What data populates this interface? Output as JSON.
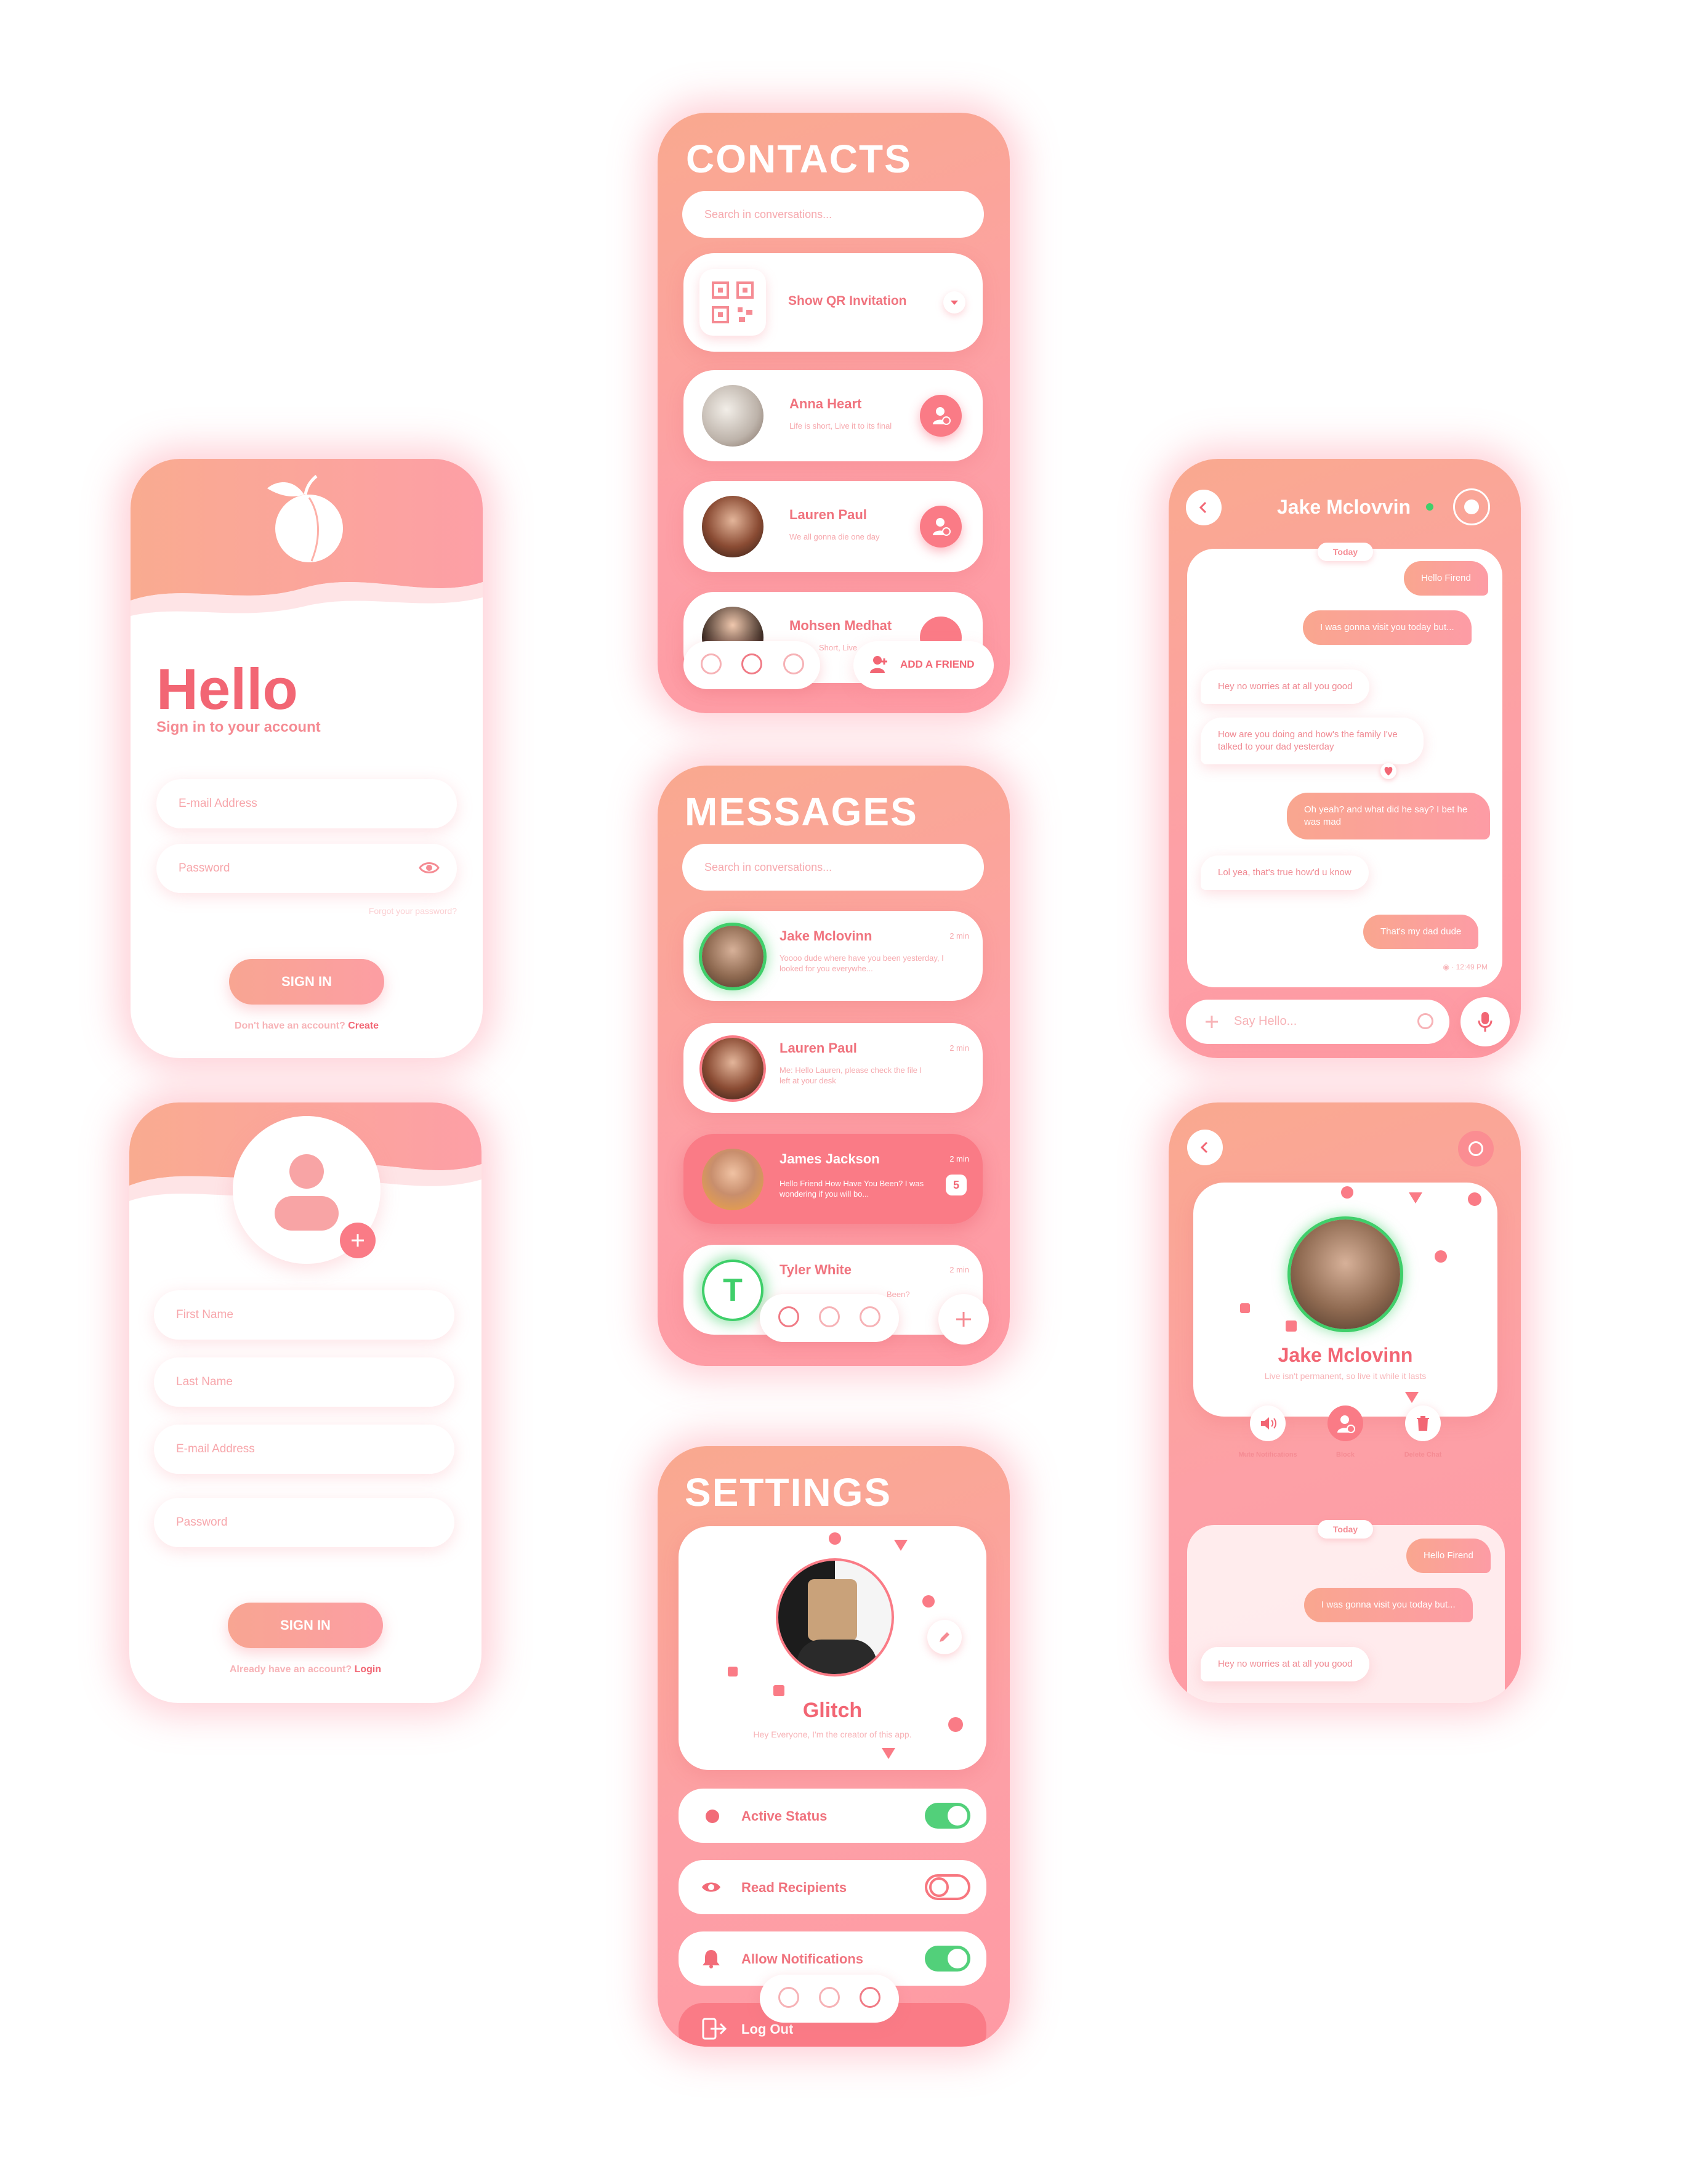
{
  "login": {
    "title": "Hello",
    "subtitle": "Sign in to your account",
    "email_placeholder": "E-mail Address",
    "password_placeholder": "Password",
    "forgot": "Forgot your password?",
    "button": "SIGN IN",
    "footer_text": "Don't have an account?",
    "footer_link": "Create"
  },
  "register": {
    "first_name": "First Name",
    "last_name": "Last Name",
    "email": "E-mail Address",
    "password": "Password",
    "button": "SIGN IN",
    "footer_text": "Already have an account?",
    "footer_link": "Login"
  },
  "contacts": {
    "title": "CONTACTS",
    "search_placeholder": "Search in conversations...",
    "qr_label": "Show QR Invitation",
    "items": [
      {
        "name": "Anna Heart",
        "status": "Life is short, Live it to its final"
      },
      {
        "name": "Lauren Paul",
        "status": "We all gonna die one day"
      },
      {
        "name": "Mohsen Medhat",
        "status": "Short, Live"
      }
    ],
    "add_friend": "ADD A FRIEND"
  },
  "messages": {
    "title": "MESSAGES",
    "search_placeholder": "Search in conversations...",
    "items": [
      {
        "name": "Jake Mclovinn",
        "time": "2 min",
        "preview": "Yoooo dude where have you been yesterday, I looked for you everywhe..."
      },
      {
        "name": "Lauren Paul",
        "time": "2 min",
        "preview": "Me: Hello Lauren, please check the file I left at your desk"
      },
      {
        "name": "James Jackson",
        "time": "2 min",
        "preview": "Hello Friend How Have You Been? I was wondering if you will bo...",
        "badge": "5"
      },
      {
        "name": "Tyler White",
        "time": "2 min",
        "preview": "Been?",
        "initial": "T"
      }
    ]
  },
  "settings": {
    "title": "SETTINGS",
    "profile_name": "Glitch",
    "profile_bio": "Hey Everyone, I'm the creator of this app.",
    "rows": [
      {
        "label": "Active Status",
        "on": true
      },
      {
        "label": "Read Recipients",
        "on": false
      },
      {
        "label": "Allow Notifications",
        "on": true
      }
    ],
    "logout": "Log Out"
  },
  "chat": {
    "name": "Jake Mclovvin",
    "today": "Today",
    "messages": [
      {
        "side": "right",
        "text": "Hello Firend"
      },
      {
        "side": "right",
        "text": "I was gonna visit you today but..."
      },
      {
        "side": "left",
        "text": "Hey no worries at at all you good"
      },
      {
        "side": "left",
        "text": "How are you doing and how's the family I've talked to your dad yesterday"
      },
      {
        "side": "right",
        "text": "Oh yeah? and what did he say? I bet he was mad"
      },
      {
        "side": "left",
        "text": "Lol yea, that's true how'd u know"
      },
      {
        "side": "right",
        "text": "That's my dad dude"
      }
    ],
    "seen_time": "12:49 PM",
    "input_placeholder": "Say Hello..."
  },
  "profile": {
    "name": "Jake Mclovinn",
    "bio": "Live isn't permanent, so live it while it lasts",
    "actions": [
      "Mute Notifications",
      "Block",
      "Delete Chat"
    ],
    "today": "Today",
    "messages": [
      {
        "side": "right",
        "text": "Hello Firend"
      },
      {
        "side": "right",
        "text": "I was gonna visit you today but..."
      },
      {
        "side": "left",
        "text": "Hey no worries at at all you good"
      }
    ]
  }
}
